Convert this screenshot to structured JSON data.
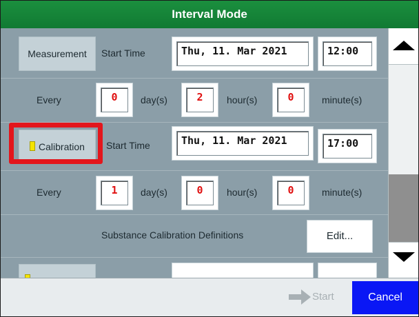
{
  "window": {
    "title": "Interval Mode"
  },
  "measurement": {
    "mode_label": "Measurement",
    "start_label": "Start Time",
    "date": "Thu,  11.  Mar  2021",
    "time": "12:00",
    "every_label": "Every",
    "days": "0",
    "days_unit": "day(s)",
    "hours": "2",
    "hours_unit": "hour(s)",
    "minutes": "0",
    "minutes_unit": "minute(s)"
  },
  "calibration": {
    "mode_label": "Calibration",
    "start_label": "Start Time",
    "date": "Thu,  11.  Mar  2021",
    "time": "17:00",
    "every_label": "Every",
    "days": "1",
    "days_unit": "day(s)",
    "hours": "0",
    "hours_unit": "hour(s)",
    "minutes": "0",
    "minutes_unit": "minute(s)",
    "definitions_label": "Substance Calibration Definitions",
    "edit_label": "Edit..."
  },
  "footer": {
    "start_label": "Start",
    "cancel_label": "Cancel"
  },
  "icons": {
    "scroll_up": "triangle-up-icon",
    "scroll_down": "triangle-down-icon",
    "start": "arrow-right-icon",
    "mode_flag": "yellow-flag-icon"
  },
  "colors": {
    "title_bar": "#1b8f3e",
    "value_text": "#e01010",
    "highlight": "#e3161c",
    "cancel": "#0a17f5"
  }
}
